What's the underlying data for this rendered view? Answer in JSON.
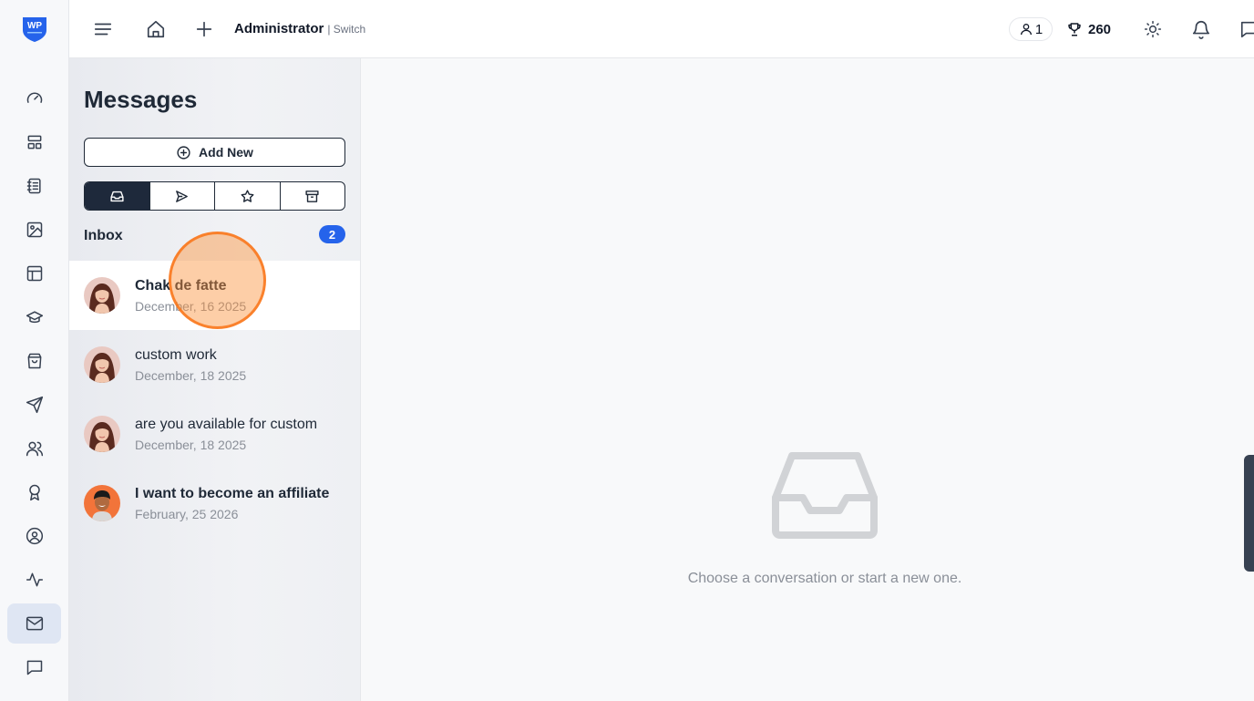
{
  "app": {
    "logo_text": "WP",
    "brand_color": "#2563eb"
  },
  "rail": {
    "items": [
      {
        "name": "dashboard-icon"
      },
      {
        "name": "layout-icon"
      },
      {
        "name": "notebook-icon"
      },
      {
        "name": "image-icon"
      },
      {
        "name": "template-icon"
      },
      {
        "name": "graduation-cap-icon"
      },
      {
        "name": "shopping-bag-icon"
      },
      {
        "name": "send-icon"
      },
      {
        "name": "users-icon"
      },
      {
        "name": "award-icon"
      },
      {
        "name": "user-circle-icon"
      },
      {
        "name": "activity-icon"
      },
      {
        "name": "mail-icon",
        "active": true
      },
      {
        "name": "chat-icon"
      }
    ]
  },
  "topbar": {
    "user": "Administrator",
    "switch_label": "| Switch",
    "online_count": "1",
    "points": "260"
  },
  "messages": {
    "title": "Messages",
    "add_new_label": "Add New",
    "tabs": [
      "inbox-icon",
      "send-icon",
      "star-icon",
      "archive-icon"
    ],
    "active_tab": "inbox",
    "inbox_label": "Inbox",
    "inbox_count": "2",
    "items": [
      {
        "subject": "Chak de fatte",
        "date": "December, 16 2025",
        "bold": true,
        "selected": true
      },
      {
        "subject": "custom work",
        "date": "December, 18 2025",
        "bold": false
      },
      {
        "subject": "are you available for custom",
        "date": "December, 18 2025",
        "bold": false
      },
      {
        "subject": "I want to become an affiliate",
        "date": "February, 25 2026",
        "bold": true
      }
    ]
  },
  "empty_state": {
    "text": "Choose a conversation or start a new one."
  }
}
